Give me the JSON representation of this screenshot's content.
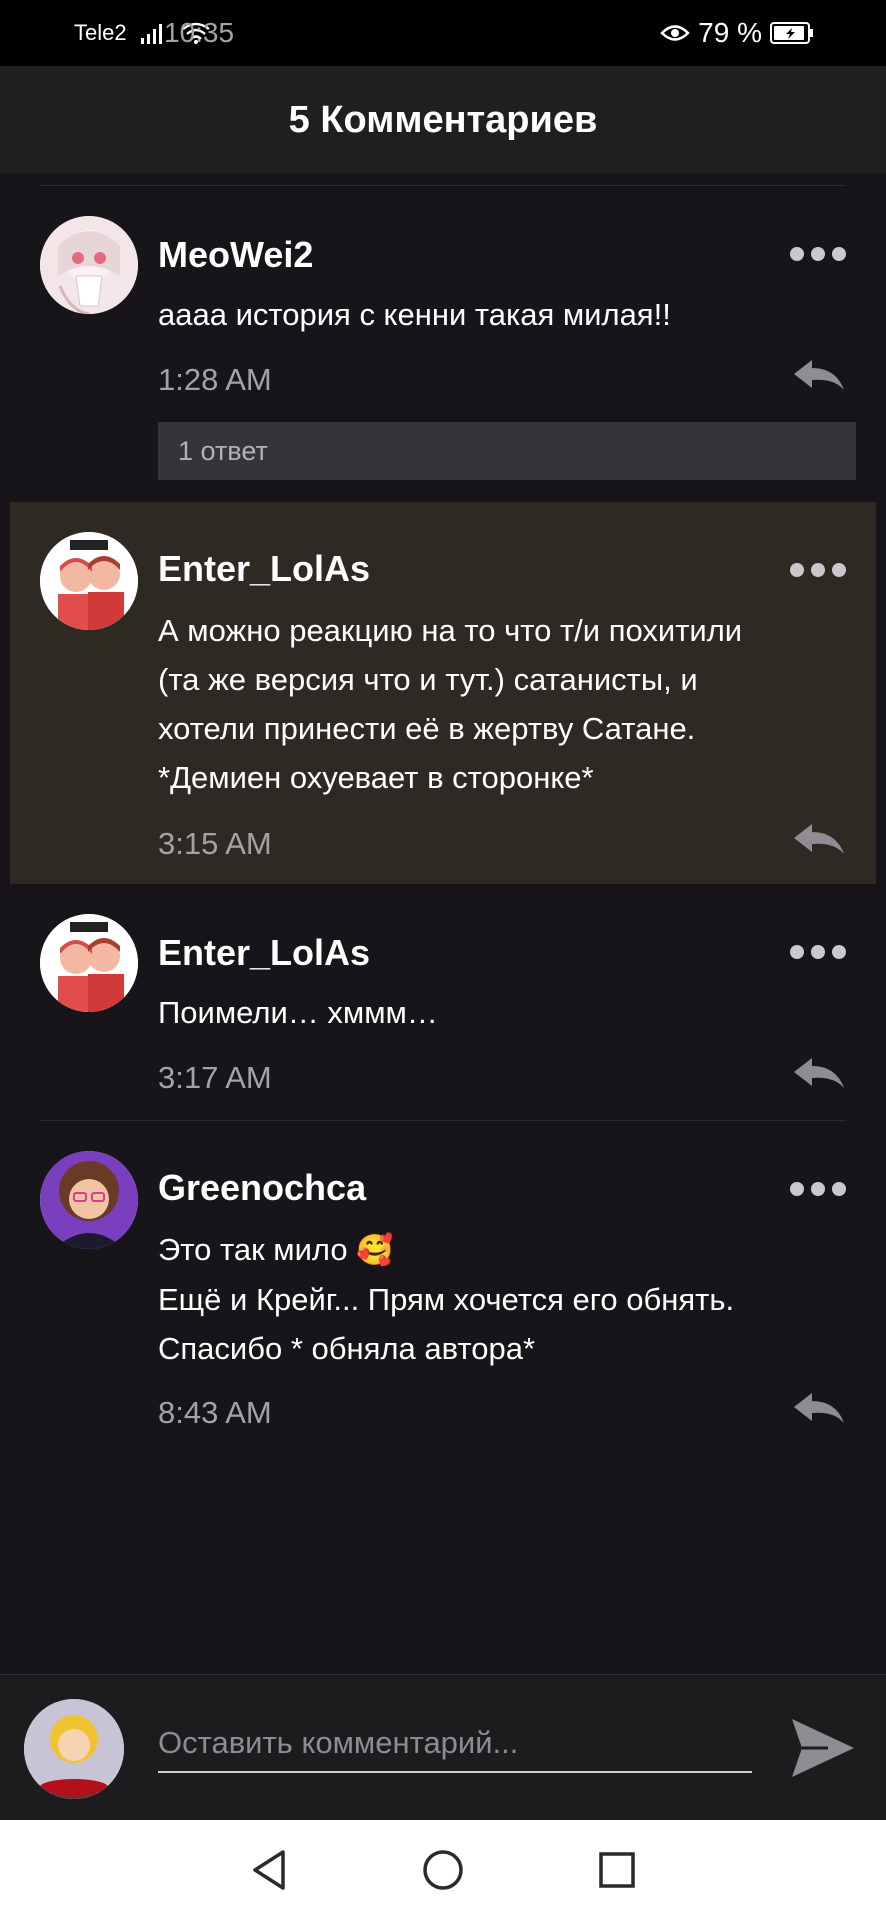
{
  "status_bar": {
    "carrier": "Tele2",
    "battery": "79 %",
    "time": "10:35"
  },
  "header": {
    "title": "5 Комментариев"
  },
  "comments": [
    {
      "author": "MeoWei2",
      "lines": [
        "аааа история с кенни такая милая!!"
      ],
      "time": "1:28 AM",
      "replies_label": "1 ответ"
    },
    {
      "author": "Enter_LolAs",
      "lines": [
        "А можно реакцию на то что т/и похитили",
        "(та же версия что и тут.) сатанисты, и",
        "хотели принести её в жертву Сатане.",
        "*Демиен охуевает в сторонке*"
      ],
      "time": "3:15 AM",
      "highlighted": true
    },
    {
      "author": "Enter_LolAs",
      "lines": [
        "Поимели… хммм…"
      ],
      "time": "3:17 AM"
    },
    {
      "author": "Greenochca",
      "lines": [
        "Это так мило",
        "Ещё и Крейг... Прям хочется его обнять.",
        "Спасибо * обняла автора*"
      ],
      "time": "8:43 AM"
    }
  ],
  "composer": {
    "placeholder": "Оставить комментарий..."
  },
  "colors": {
    "background": "#17151a",
    "highlight": "#2f2924",
    "header": "#1f1e21"
  }
}
